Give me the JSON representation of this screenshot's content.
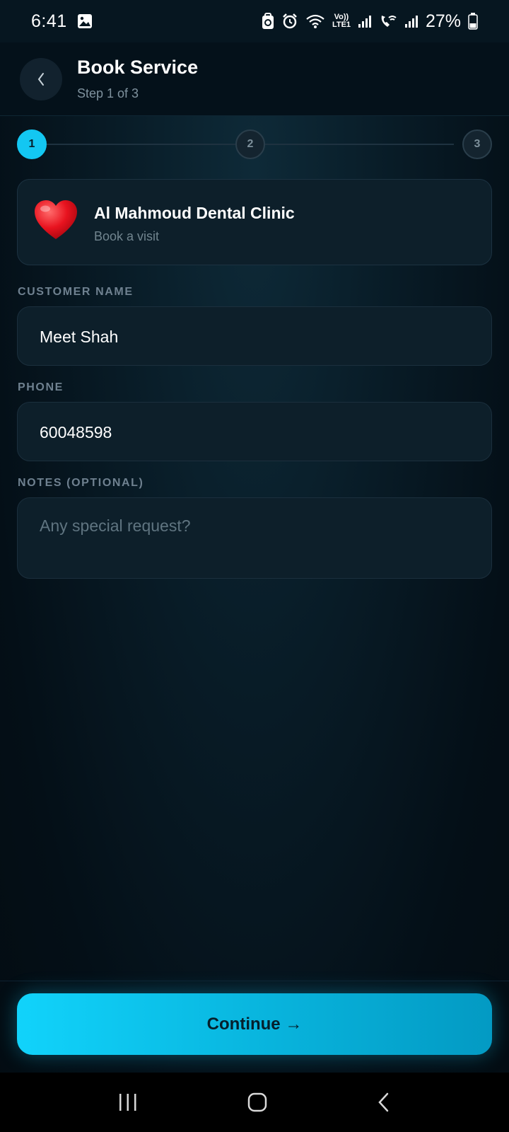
{
  "status_bar": {
    "time": "6:41",
    "battery": "27%",
    "icons": [
      "image-icon",
      "sync-icon",
      "alarm-icon",
      "wifi-icon",
      "volte-icon",
      "signal-icon",
      "wifi-call-icon",
      "signal-icon",
      "battery-icon"
    ],
    "volte_label": "Vo)) LTE1"
  },
  "header": {
    "title": "Book Service",
    "subtitle": "Step 1 of 3",
    "back_icon": "chevron-left-icon"
  },
  "stepper": {
    "steps": [
      "1",
      "2",
      "3"
    ],
    "active_step": 1,
    "accent_color": "#13c7f2"
  },
  "clinic": {
    "name": "Al Mahmoud Dental Clinic",
    "subtitle": "Book a visit",
    "icon": "heart-icon"
  },
  "form": {
    "customer_name": {
      "label": "CUSTOMER NAME",
      "value": "Meet Shah"
    },
    "phone": {
      "label": "PHONE",
      "value": "60048598"
    },
    "notes": {
      "label": "NOTES (OPTIONAL)",
      "placeholder": "Any special request?",
      "value": ""
    }
  },
  "continue_button": {
    "label": "Continue →"
  },
  "nav_bar": {
    "icons": [
      "recent-apps-icon",
      "home-icon",
      "back-icon"
    ]
  }
}
